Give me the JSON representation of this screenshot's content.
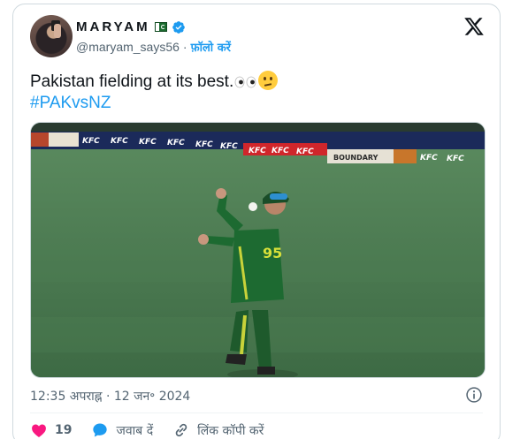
{
  "author": {
    "display_name": "MARYAM",
    "handle": "@maryam_says56",
    "separator": "·",
    "follow_label": "फ़ॉलो करें"
  },
  "tweet": {
    "text": "Pakistan fielding at its best.",
    "hashtag": "#PAKvsNZ",
    "timestamp": "12:35 अपराह्न · 12 जन॰ 2024"
  },
  "media": {
    "boundary_ads": [
      "KFC",
      "KFC",
      "KFC",
      "KFC",
      "KFC",
      "KFC",
      "KFC",
      "KFC",
      "KFC",
      "KFC",
      "KFC"
    ],
    "banner_text": "BOUNDARY",
    "player_number": "95"
  },
  "actions": {
    "like_count": "19",
    "reply_label": "जवाब दें",
    "copy_link_label": "लिंक कॉपी करें"
  },
  "colors": {
    "accent": "#1d9bf0",
    "like": "#f91880",
    "text": "#0f1419",
    "muted": "#536471"
  },
  "icons": [
    "x-logo-icon",
    "verified-badge-icon",
    "pakistan-flag-icon",
    "info-icon",
    "heart-icon",
    "reply-bubble-icon",
    "link-icon"
  ]
}
